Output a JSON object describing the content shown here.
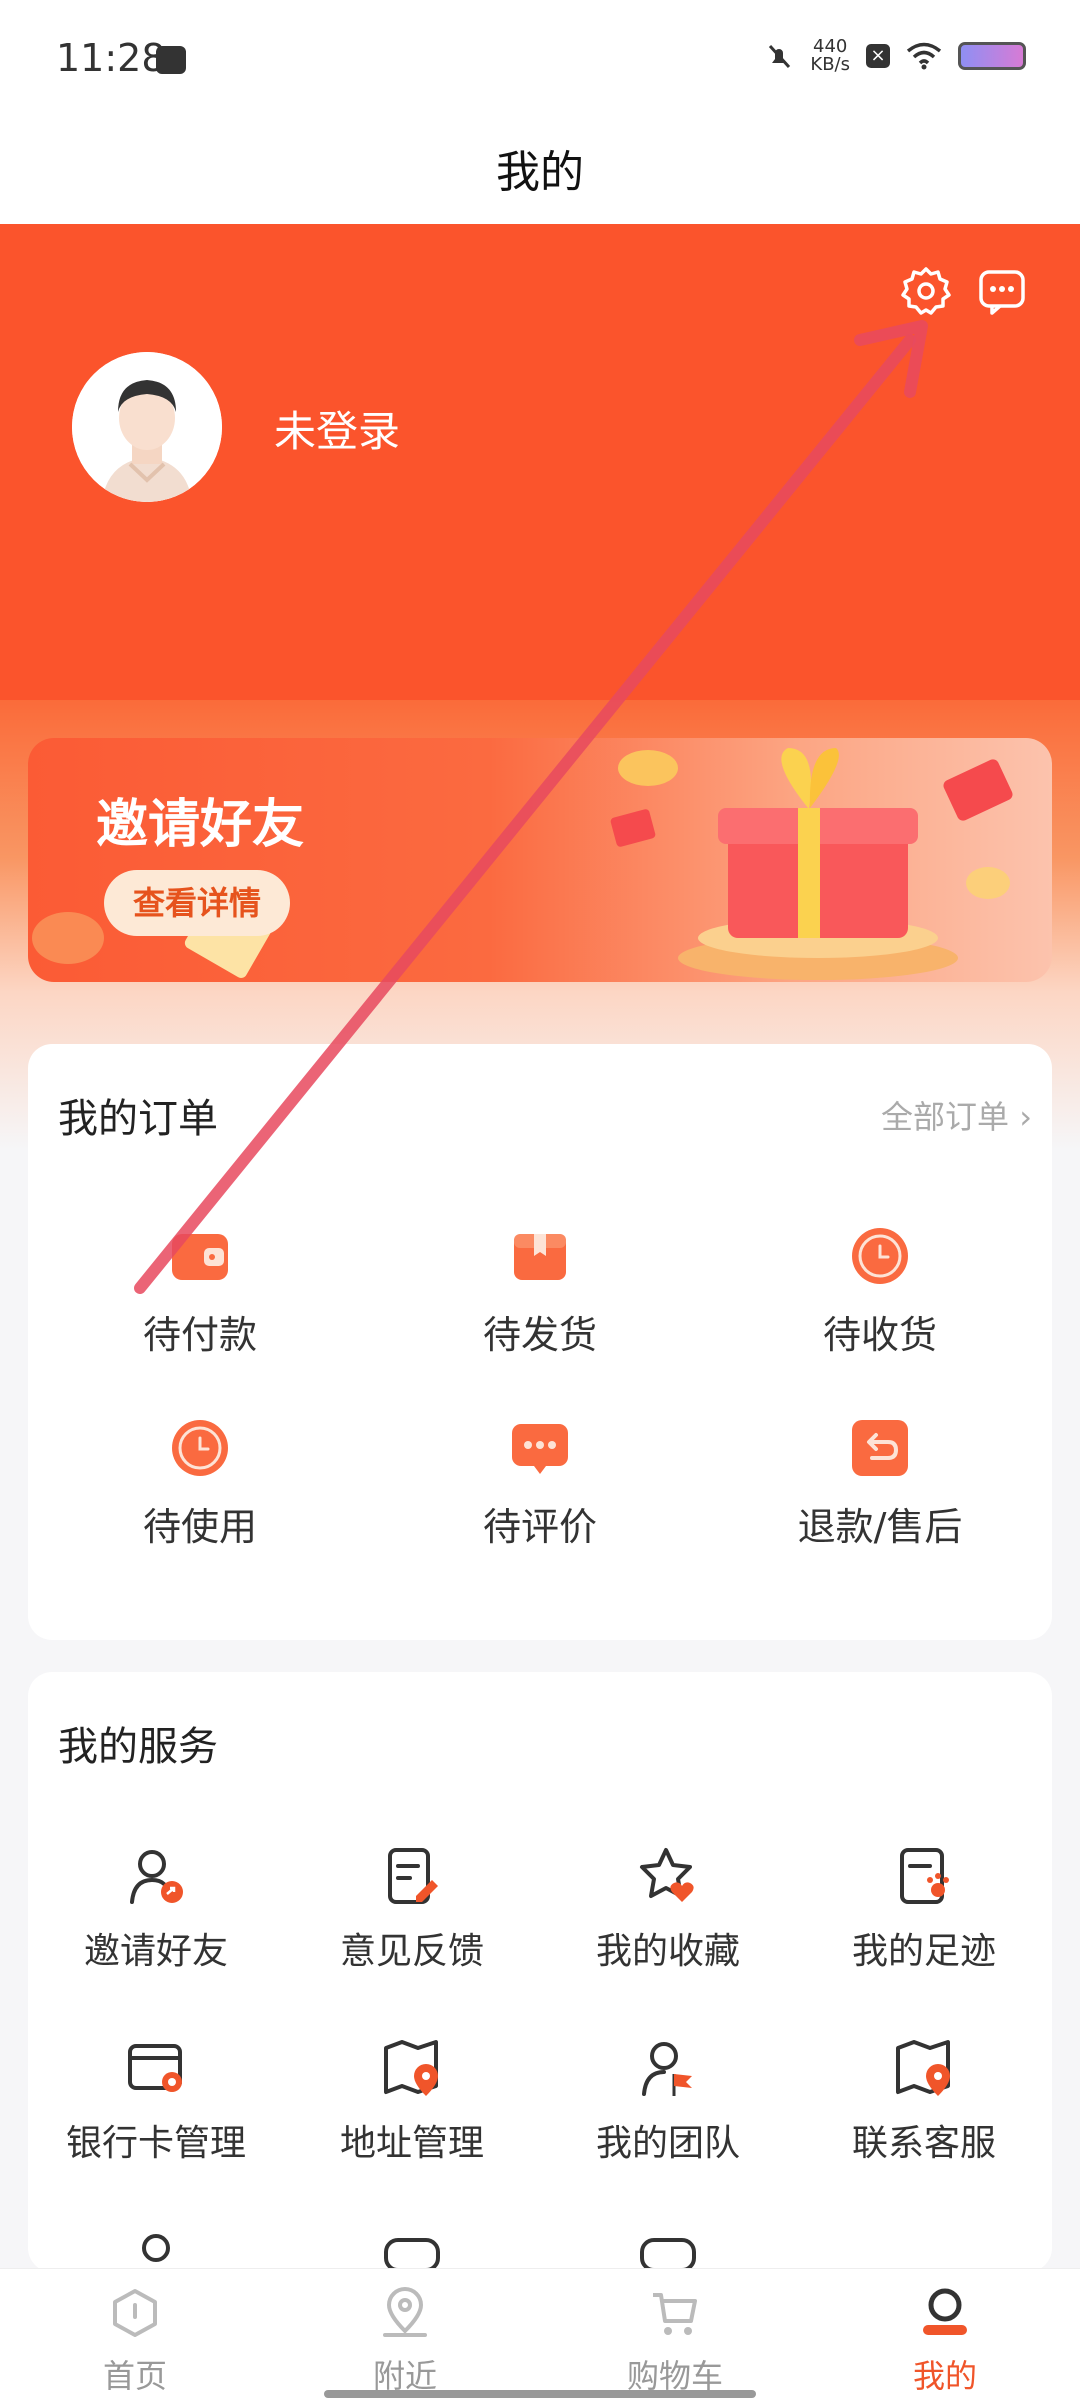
{
  "status": {
    "time": "11:28",
    "speed_top": "440",
    "speed_unit": "KB/s"
  },
  "header": {
    "title": "我的"
  },
  "profile": {
    "username": "未登录"
  },
  "banner": {
    "title": "邀请好友",
    "button": "查看详情"
  },
  "orders": {
    "title": "我的订单",
    "view_all": "全部订单",
    "items": [
      {
        "label": "待付款",
        "icon": "wallet-icon"
      },
      {
        "label": "待发货",
        "icon": "package-icon"
      },
      {
        "label": "待收货",
        "icon": "clock-icon"
      },
      {
        "label": "待使用",
        "icon": "clock-icon"
      },
      {
        "label": "待评价",
        "icon": "comment-icon"
      },
      {
        "label": "退款/售后",
        "icon": "return-icon"
      }
    ]
  },
  "services": {
    "title": "我的服务",
    "items": [
      {
        "label": "邀请好友",
        "icon": "invite-user-icon"
      },
      {
        "label": "意见反馈",
        "icon": "feedback-icon"
      },
      {
        "label": "我的收藏",
        "icon": "favorite-icon"
      },
      {
        "label": "我的足迹",
        "icon": "footprint-icon"
      },
      {
        "label": "银行卡管理",
        "icon": "bank-card-icon"
      },
      {
        "label": "地址管理",
        "icon": "address-icon"
      },
      {
        "label": "我的团队",
        "icon": "team-icon"
      },
      {
        "label": "联系客服",
        "icon": "customer-service-icon"
      }
    ]
  },
  "tabbar": {
    "tabs": [
      {
        "label": "首页",
        "icon": "home-icon"
      },
      {
        "label": "附近",
        "icon": "location-icon"
      },
      {
        "label": "购物车",
        "icon": "cart-icon"
      },
      {
        "label": "我的",
        "icon": "profile-icon",
        "active": true
      }
    ]
  },
  "colors": {
    "accent": "#fb542c",
    "active_tab": "#f0552a"
  }
}
